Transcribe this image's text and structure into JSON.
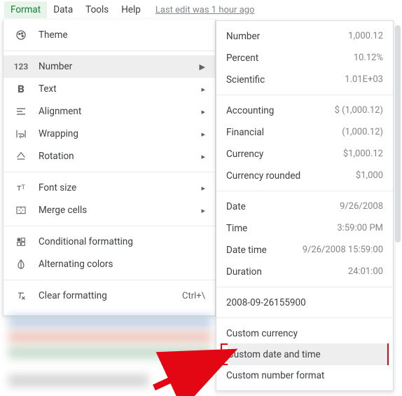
{
  "menubar": {
    "format": "Format",
    "data": "Data",
    "tools": "Tools",
    "help": "Help",
    "last_edit": "Last edit was 1 hour ago"
  },
  "format_menu": {
    "theme": "Theme",
    "number": "Number",
    "text": "Text",
    "alignment": "Alignment",
    "wrapping": "Wrapping",
    "rotation": "Rotation",
    "font_size": "Font size",
    "merge_cells": "Merge cells",
    "conditional_formatting": "Conditional formatting",
    "alternating_colors": "Alternating colors",
    "clear_formatting": "Clear formatting",
    "clear_formatting_shortcut": "Ctrl+\\"
  },
  "number_submenu": {
    "number": {
      "label": "Number",
      "example": "1,000.12"
    },
    "percent": {
      "label": "Percent",
      "example": "10.12%"
    },
    "scientific": {
      "label": "Scientific",
      "example": "1.01E+03"
    },
    "accounting": {
      "label": "Accounting",
      "example": "$ (1,000.12)"
    },
    "financial": {
      "label": "Financial",
      "example": "(1,000.12)"
    },
    "currency": {
      "label": "Currency",
      "example": "$1,000.12"
    },
    "currency_rounded": {
      "label": "Currency rounded",
      "example": "$1,000"
    },
    "date": {
      "label": "Date",
      "example": "9/26/2008"
    },
    "time": {
      "label": "Time",
      "example": "3:59:00 PM"
    },
    "datetime": {
      "label": "Date time",
      "example": "9/26/2008 15:59:00"
    },
    "duration": {
      "label": "Duration",
      "example": "24:01:00"
    },
    "iso": {
      "label": "2008-09-26155900"
    },
    "custom_currency": "Custom currency",
    "custom_datetime": "Custom date and time",
    "custom_number": "Custom number format"
  }
}
